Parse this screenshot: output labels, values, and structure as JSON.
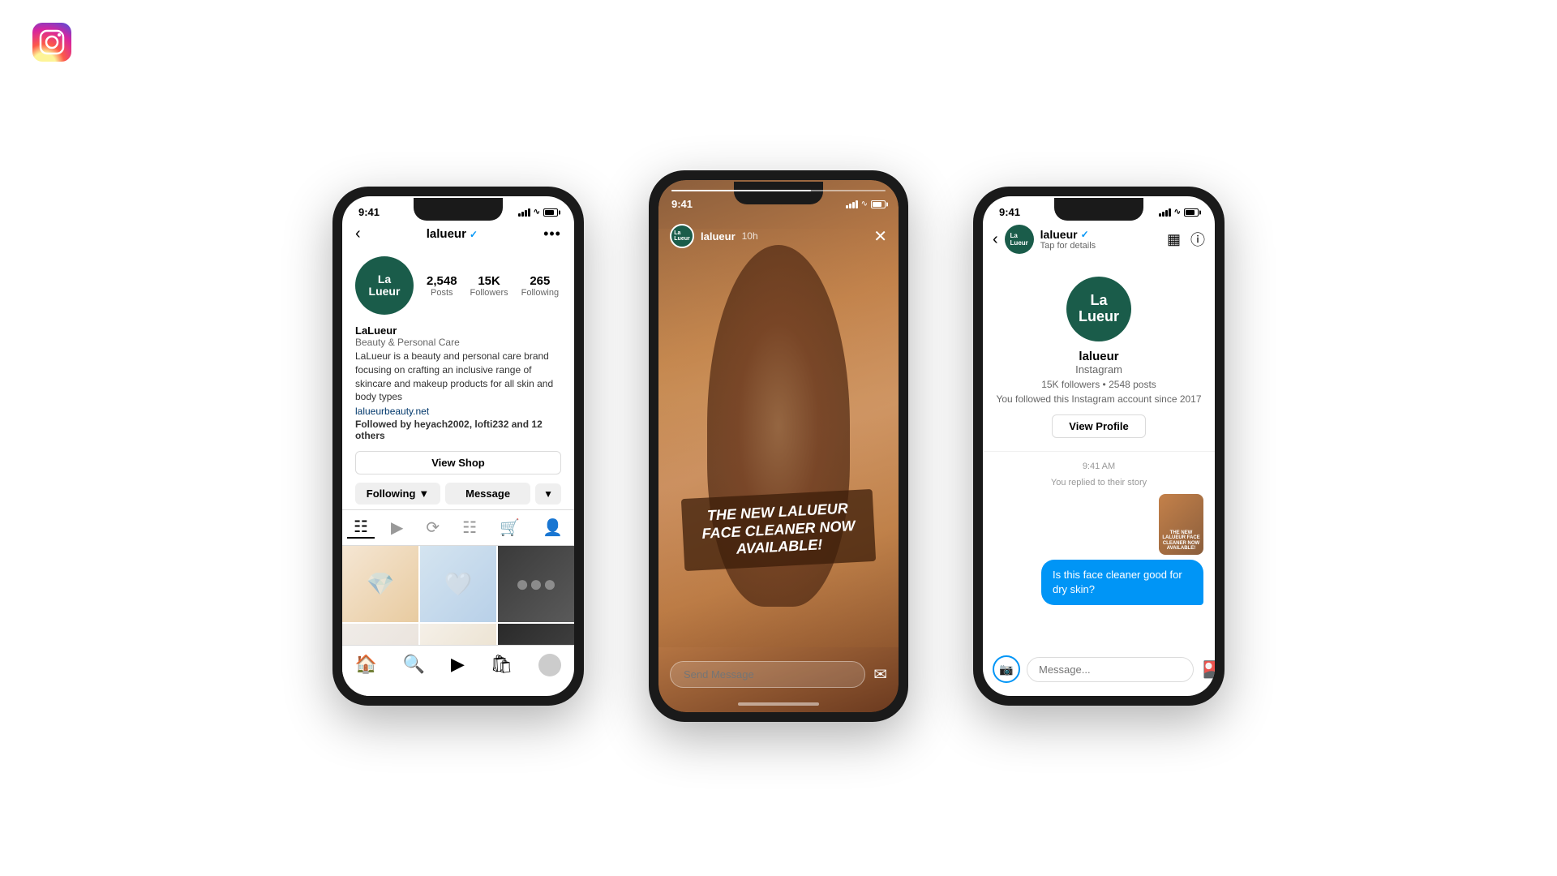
{
  "app": {
    "logo_alt": "Instagram"
  },
  "phone1": {
    "status_time": "9:41",
    "username": "lalueur",
    "verified": "✓",
    "more_icon": "•••",
    "stats": {
      "posts_count": "2,548",
      "posts_label": "Posts",
      "followers_count": "15K",
      "followers_label": "Followers",
      "following_count": "265",
      "following_label": "Following"
    },
    "bio_name": "LaLueur",
    "bio_category": "Beauty & Personal Care",
    "bio_text": "LaLueur is a beauty and personal care brand focusing on crafting an inclusive range of skincare and makeup products for all skin and body types",
    "bio_link": "lalueurbeauty.net",
    "bio_followed": "Followed by heyach2002, lofti232 and",
    "bio_followed_count": "12 others",
    "view_shop_label": "View Shop",
    "following_btn_label": "Following",
    "message_btn_label": "Message",
    "avatar_line1": "La",
    "avatar_line2": "Lueur"
  },
  "phone2": {
    "status_time": "9:41",
    "story_username": "lalueur",
    "story_time_ago": "10h",
    "story_text": "THE NEW LALUEUR FACE CLEANER NOW AVAILABLE!",
    "send_message_placeholder": "Send Message"
  },
  "phone3": {
    "status_time": "9:41",
    "username": "lalueur",
    "verified": "✓",
    "tap_for_details": "Tap for details",
    "profile_name": "lalueur",
    "profile_platform": "Instagram",
    "profile_stats": "15K followers • 2548 posts",
    "profile_since": "You followed this Instagram account since 2017",
    "view_profile_label": "View Profile",
    "time_label": "9:41 AM",
    "replied_label": "You replied to their story",
    "story_thumb_text": "THE NEW LALUEUR FACE CLEANER NOW AVAILABLE!",
    "message_text": "Is this face cleaner good for dry skin?",
    "message_placeholder": "Message...",
    "avatar_line1": "La",
    "avatar_line2": "Lueur"
  }
}
